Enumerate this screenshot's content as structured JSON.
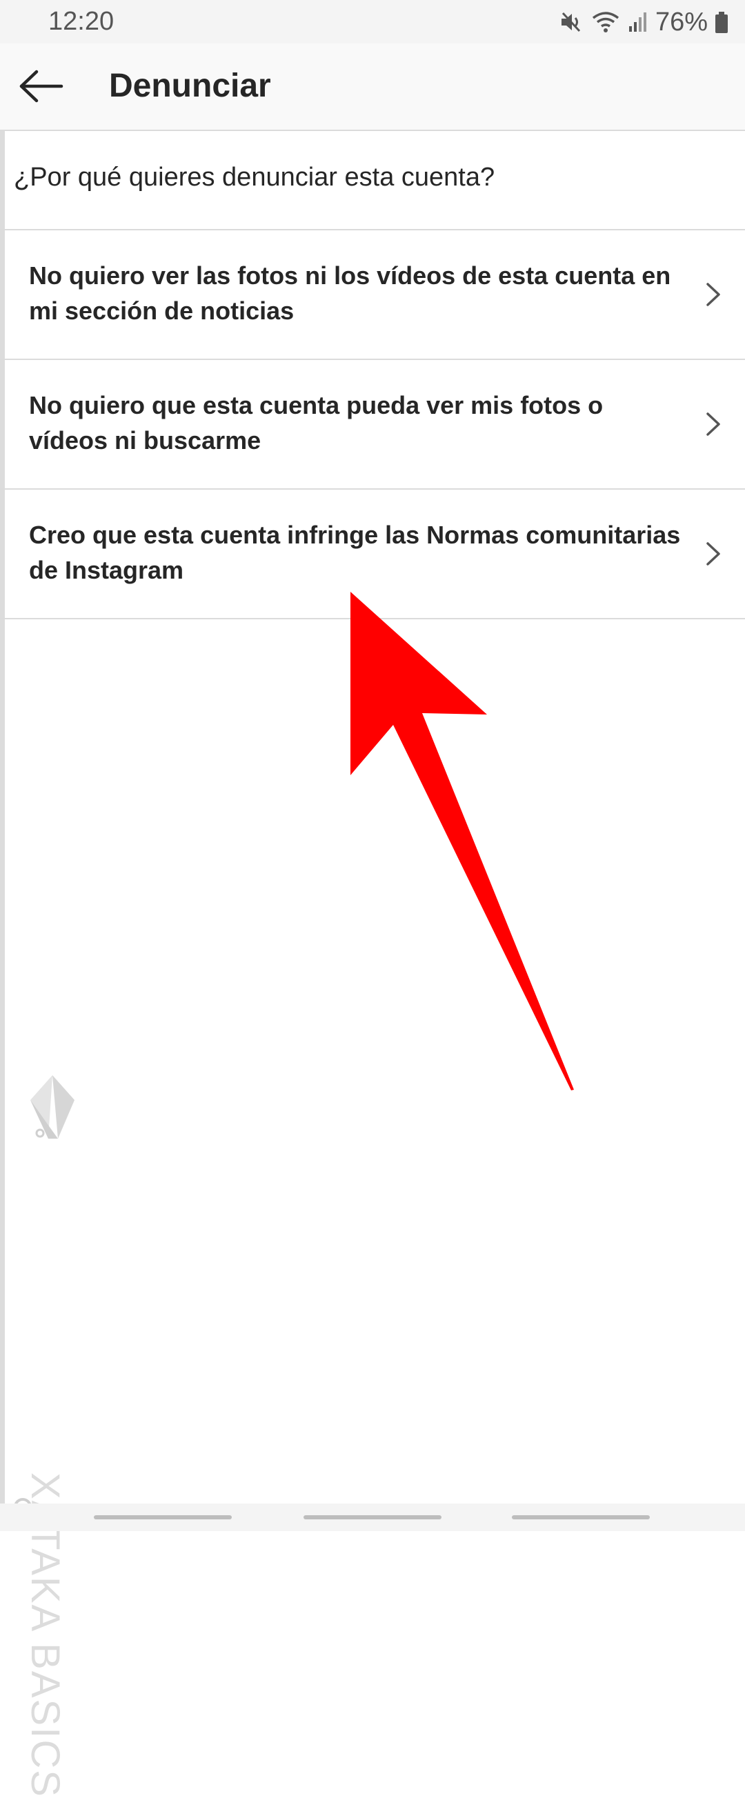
{
  "status_bar": {
    "time": "12:20",
    "battery_percent": "76%",
    "icons": [
      "mute-icon",
      "wifi-icon",
      "signal-icon",
      "battery-icon"
    ]
  },
  "header": {
    "title": "Denunciar",
    "back_icon": "arrow-left-icon"
  },
  "question": "¿Por qué quieres denunciar esta cuenta?",
  "options": [
    {
      "label": "No quiero ver las fotos ni los vídeos de esta cuenta en mi sección de noticias"
    },
    {
      "label": "No quiero que esta cuenta pueda ver mis fotos o vídeos ni buscarme"
    },
    {
      "label": "Creo que esta cuenta infringe las Normas comunitarias de Instagram"
    }
  ],
  "annotation": {
    "arrow_color": "#ff0000"
  },
  "watermark": {
    "text": "XATAKA BASICS"
  },
  "colors": {
    "text": "#262626",
    "divider": "#dbdbdb",
    "header_bg": "#f9f9f9"
  }
}
